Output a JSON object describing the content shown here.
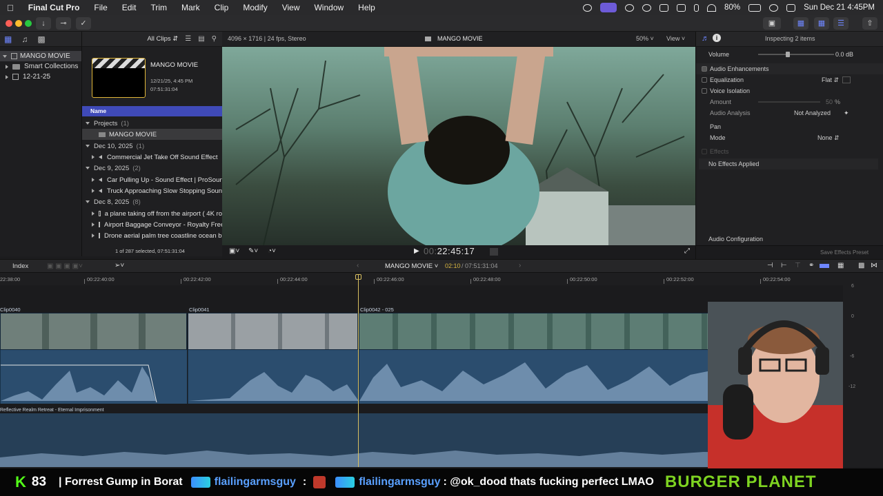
{
  "menubar": {
    "app_name": "Final Cut Pro",
    "items": [
      "File",
      "Edit",
      "Trim",
      "Mark",
      "Clip",
      "Modify",
      "View",
      "Window",
      "Help"
    ],
    "battery": "80%",
    "datetime": "Sun Dec 21  4:45PM"
  },
  "library": {
    "items": [
      {
        "label": "MANGO MOVIE",
        "selected": true
      },
      {
        "label": "Smart Collections"
      },
      {
        "label": "12-21-25"
      }
    ]
  },
  "browser": {
    "filter": "All Clips",
    "project_title": "MANGO MOVIE",
    "project_date": "12/21/25, 4:45 PM",
    "project_duration": "07:51:31:04",
    "column_name": "Name",
    "groups": [
      {
        "label": "Projects",
        "count": "(1)",
        "items": [
          "MANGO MOVIE"
        ]
      },
      {
        "label": "Dec 10, 2025",
        "count": "(1)",
        "items": [
          "Commercial Jet Take Off Sound Effect"
        ]
      },
      {
        "label": "Dec 9, 2025",
        "count": "(2)",
        "items": [
          "Car Pulling Up - Sound Effect  |  ProSoun",
          "Truck Approaching Slow Stopping Sound"
        ]
      },
      {
        "label": "Dec 8, 2025",
        "count": "(8)",
        "items": [
          "a plane taking off from the airport ( 4K ro",
          "Airport Baggage Conveyor - Royalty Free",
          "Drone aerial palm tree coastline ocean be"
        ]
      }
    ],
    "status": "1 of 287 selected, 07:51:31:04"
  },
  "viewer": {
    "format": "4096 × 1716 | 24 fps, Stereo",
    "title": "MANGO MOVIE",
    "zoom": "50%",
    "view_menu": "View",
    "timecode_dim": "00:",
    "timecode": "22:45:17"
  },
  "inspector": {
    "title": "Inspecting 2 items",
    "volume_label": "Volume",
    "volume_value": "0.0  dB",
    "section_enh": "Audio Enhancements",
    "eq_label": "Equalization",
    "eq_value": "Flat",
    "voice_label": "Voice Isolation",
    "amount_label": "Amount",
    "amount_value": "50",
    "amount_unit": "%",
    "analysis_label": "Audio Analysis",
    "analysis_value": "Not Analyzed",
    "pan_label": "Pan",
    "mode_label": "Mode",
    "mode_value": "None",
    "effects_label": "Effects",
    "no_effects": "No Effects Applied",
    "audio_config": "Audio Configuration",
    "save_preset": "Save Effects Preset"
  },
  "timeline": {
    "index_label": "Index",
    "project_name": "MANGO MOVIE",
    "position": "02:10",
    "duration": "/ 07:51:31:04",
    "ruler": [
      "22:38:00",
      "00:22:40:00",
      "00:22:42:00",
      "00:22:44:00",
      "00:22:46:00",
      "00:22:48:00",
      "00:22:50:00",
      "00:22:52:00",
      "00:22:54:00"
    ],
    "clips": [
      {
        "name": "Clip0040"
      },
      {
        "name": "Clip0041"
      },
      {
        "name": "Clip0042 - 025"
      }
    ],
    "music_clip": "Reflective Realm Retreat - Eternal Imprisonment",
    "meter_labels": [
      "6",
      "0",
      "-6",
      "-12"
    ]
  },
  "ticker": {
    "k_label": "K",
    "k_count": "83",
    "text1": "| Forrest Gump in Borat",
    "user1": "flailingarmsguy",
    "sep": ":",
    "user2": "flailingarmsguy",
    "text2": ": @ok_dood thats fucking perfect LMAO",
    "brand": "BURGER PLANET"
  },
  "colors": {
    "accent": "#4a5bd4",
    "selection": "#2f3f9e",
    "clip_blue": "#2e4a63",
    "playhead": "#d9c060",
    "ticker_green": "#7ed321",
    "ticker_blue": "#5aa0ff"
  }
}
